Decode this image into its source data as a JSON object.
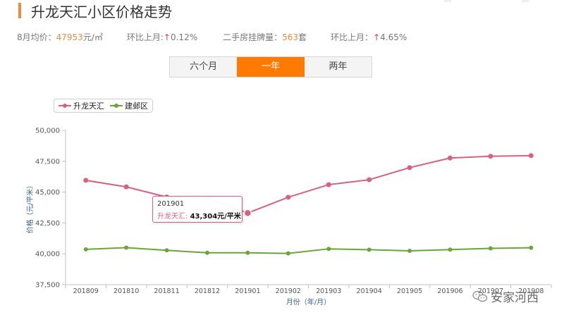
{
  "page": {
    "title": "升龙天汇小区价格走势"
  },
  "stats": {
    "avg_label": "8月均价：",
    "avg_value": "47953",
    "avg_unit": "元/㎡",
    "mom_price_label": "环比上月:",
    "mom_price_arrow": "↑",
    "mom_price_value": "0.12%",
    "listing_label": "二手房挂牌量：",
    "listing_value": "563",
    "listing_unit": "套",
    "mom_listing_label": "环比上月：",
    "mom_listing_arrow": "↑",
    "mom_listing_value": "4.65%"
  },
  "tabs": [
    {
      "label": "六个月",
      "active": false
    },
    {
      "label": "一年",
      "active": true
    },
    {
      "label": "两年",
      "active": false
    }
  ],
  "legend": [
    {
      "name": "升龙天汇",
      "color": "#d9607f"
    },
    {
      "name": "建邺区",
      "color": "#6aa53a"
    }
  ],
  "tooltip": {
    "date": "201901",
    "series": "升龙天汇:",
    "value": "43,304元/平米"
  },
  "watermark": {
    "text": "安家河西",
    "icon": "wechat-icon"
  },
  "chart_data": {
    "type": "line",
    "categories": [
      "201809",
      "201810",
      "201811",
      "201812",
      "201901",
      "201902",
      "201903",
      "201904",
      "201905",
      "201906",
      "201907",
      "201908"
    ],
    "series": [
      {
        "name": "升龙天汇",
        "color": "#d9607f",
        "values": [
          45950,
          45420,
          44600,
          44500,
          43304,
          44580,
          45600,
          46000,
          46980,
          47760,
          47900,
          47953
        ]
      },
      {
        "name": "建邺区",
        "color": "#6aa53a",
        "values": [
          40360,
          40500,
          40280,
          40080,
          40080,
          40030,
          40400,
          40330,
          40240,
          40340,
          40440,
          40490
        ]
      }
    ],
    "ylim": [
      37500,
      50000
    ],
    "yticks": [
      37500,
      40000,
      42500,
      45000,
      47500,
      50000
    ],
    "ytick_labels": [
      "37,500",
      "40,000",
      "42,500",
      "45,000",
      "47,500",
      "50,000"
    ],
    "ylabel": "价格（元/平米）",
    "xlabel": "月份（年/月）",
    "highlight_index": 4,
    "grid": false,
    "legend": "top-left"
  }
}
